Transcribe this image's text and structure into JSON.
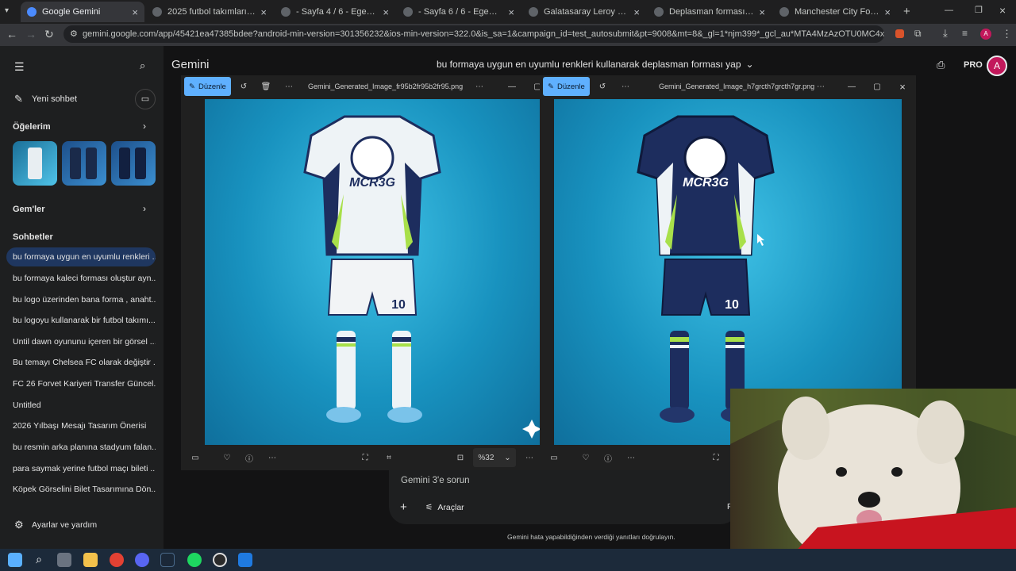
{
  "browser": {
    "tabs": [
      {
        "label": "Google Gemini",
        "active": true
      },
      {
        "label": "2025 futbol takımları forma tas"
      },
      {
        "label": "- Sayfa 4 / 6 - Egemen Spor D"
      },
      {
        "label": "- Sayfa 6 / 6 - Egemen Spor D"
      },
      {
        "label": "Galatasaray Leroy Sane Design"
      },
      {
        "label": "Deplasman forması rengi"
      },
      {
        "label": "Manchester City Forma Özel Te"
      }
    ],
    "url": "gemini.google.com/app/45421ea47385bdee?android-min-version=301356232&ios-min-version=322.0&is_sa=1&campaign_id=test_autosubmit&pt=9008&mt=8&_gl=1*njm399*_gcl_au*MTA4MzAzOTU0MC4xNzYzNzIwOTQwLjE3MDM5..."
  },
  "app": {
    "title": "Gemini",
    "conversation_title": "bu formaya uygun en uyumlu renkleri kullanarak deplasman forması yap",
    "pro_label": "PRO",
    "avatar": "A"
  },
  "sidebar": {
    "new_chat": "Yeni sohbet",
    "items_header": "Öğelerim",
    "gems_header": "Gem'ler",
    "chats_header": "Sohbetler",
    "chats": [
      "bu formaya uygun en uyumlu renkleri ...",
      "bu formaya kaleci forması oluştur ayn...",
      "bu logo üzerinden bana forma , anaht...",
      "bu logoyu kullanarak bir futbol takımı...",
      "Until dawn oyununu içeren bir görsel ...",
      "Bu temayı Chelsea FC olarak değiştir ...",
      "FC 26 Forvet Kariyeri Transfer Güncel...",
      "Untitled",
      "2026 Yılbaşı Mesajı Tasarım Önerisi",
      "bu resmin arka planına stadyum falan...",
      "para saymak yerine futbol maçı bileti ...",
      "Köpek Görselini Bilet Tasarımına Dön..."
    ],
    "settings": "Ayarlar ve yardım"
  },
  "viewer_left": {
    "edit_label": "Düzenle",
    "filename": "Gemini_Generated_Image_fr95b2fr95b2fr95.png"
  },
  "viewer_right": {
    "edit_label": "Düzenle",
    "filename": "Gemini_Generated_Image_h7grcth7grcth7gr.png",
    "zoom": "%32"
  },
  "jersey": {
    "logo_text": "MCR3G",
    "number": "10"
  },
  "composer": {
    "placeholder": "Gemini 3'e sorun",
    "tools": "Araçlar",
    "disclaimer": "Gemini hata yapabildiğinden verdiği yanıtları doğrulayın.",
    "send_hint": "F"
  },
  "colors": {
    "accent": "#5fb0ff",
    "gemini_blue": "#1f3760",
    "teal_bg": "#1a9bc3",
    "navy": "#1d2d5e",
    "lime": "#a8e04a"
  }
}
